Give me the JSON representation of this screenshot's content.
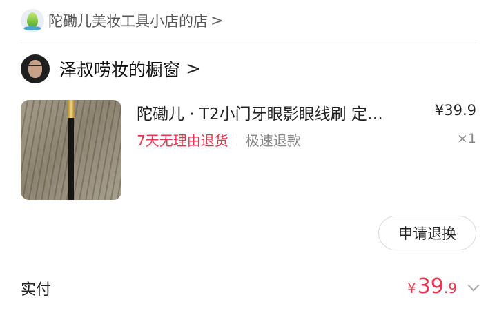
{
  "store": {
    "name": "陀磡儿美妆工具小店的店",
    "chevron": ">"
  },
  "showcase": {
    "name": "泽叔唠妆的橱窗",
    "chevron": ">"
  },
  "product": {
    "title": "陀磡儿 · T2小门牙眼影眼线刷 定…",
    "price": "¥39.9",
    "tag_return": "7天无理由退货",
    "tag_refund": "极速退款",
    "quantity": "×1"
  },
  "actions": {
    "refund_button": "申请退换"
  },
  "payment": {
    "label": "实付",
    "currency": "¥",
    "amount_int": "39",
    "amount_dec": ".9"
  },
  "colors": {
    "accent_red": "#e8364f",
    "muted_gray": "#888888"
  }
}
